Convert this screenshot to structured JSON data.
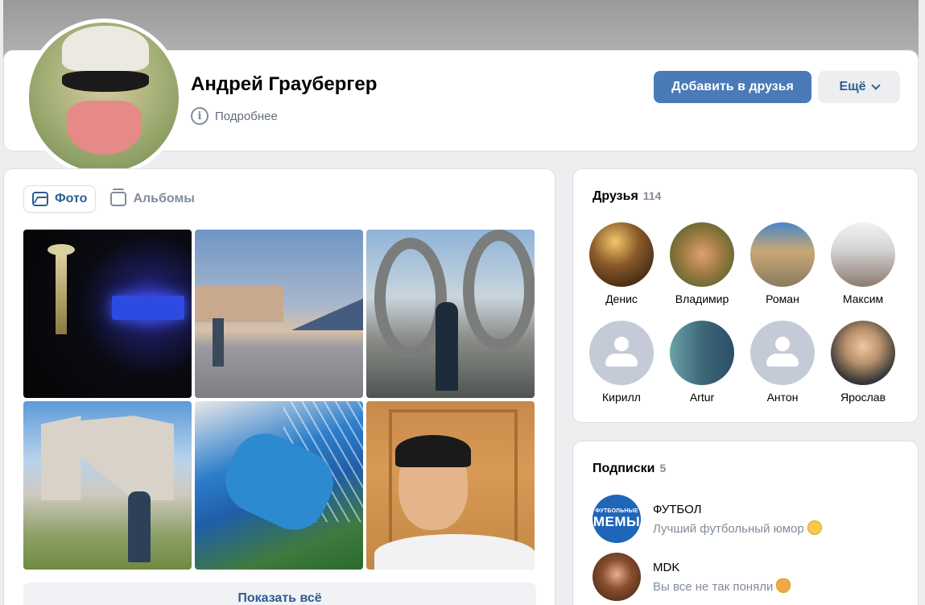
{
  "profile": {
    "name": "Андрей Граубергер",
    "details_label": "Подробнее",
    "add_friend_label": "Добавить в друзья",
    "more_label": "Ещё"
  },
  "photos": {
    "tabs": [
      {
        "label": "Фото",
        "icon": "image-icon",
        "active": true
      },
      {
        "label": "Альбомы",
        "icon": "albums-icon",
        "active": false
      }
    ],
    "show_all_label": "Показать всё"
  },
  "friends": {
    "title": "Друзья",
    "count": "114",
    "items": [
      {
        "name": "Денис"
      },
      {
        "name": "Владимир"
      },
      {
        "name": "Роман"
      },
      {
        "name": "Максим"
      },
      {
        "name": "Кирилл"
      },
      {
        "name": "Artur"
      },
      {
        "name": "Антон"
      },
      {
        "name": "Ярослав"
      }
    ]
  },
  "subscriptions": {
    "title": "Подписки",
    "count": "5",
    "items": [
      {
        "name": "ФУТБОЛ",
        "description": "Лучший футбольный юмор",
        "avatar_text_small": "ФУТБОЛЬНЫЕ",
        "avatar_text_big": "МЕМЫ",
        "emoji": "grinning-face-icon"
      },
      {
        "name": "MDK",
        "description": "Вы все не так поняли",
        "emoji": "cat-face-icon"
      }
    ]
  },
  "colors": {
    "accent": "#4a7ab8",
    "link": "#2c5d94",
    "background": "#edeef0",
    "secondary_text": "#818c99"
  }
}
